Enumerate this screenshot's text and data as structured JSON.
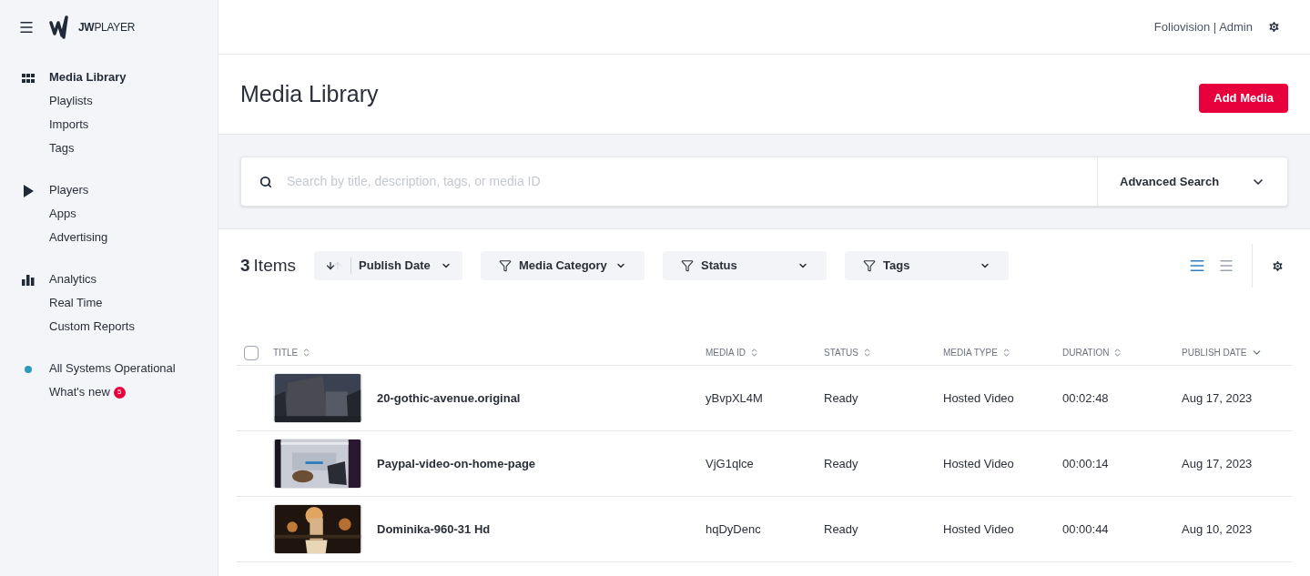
{
  "logo": {
    "text": "**JW**PLAYER"
  },
  "sidebar": {
    "groups": [
      {
        "items": [
          {
            "label": "Media Library",
            "selected": true
          },
          {
            "label": "Playlists",
            "selected": false
          },
          {
            "label": "Imports",
            "selected": false
          },
          {
            "label": "Tags",
            "selected": false
          }
        ]
      },
      {
        "items": [
          {
            "label": "Players",
            "selected": false
          },
          {
            "label": "Apps",
            "selected": false
          },
          {
            "label": "Advertising",
            "selected": false
          }
        ]
      },
      {
        "items": [
          {
            "label": "Analytics",
            "selected": false
          },
          {
            "label": "Real Time",
            "selected": false
          },
          {
            "label": "Custom Reports",
            "selected": false
          }
        ]
      },
      {
        "items": [
          {
            "label": "All Systems Operational",
            "selected": false
          },
          {
            "label": "What's new",
            "selected": false,
            "badge": "5"
          }
        ]
      }
    ]
  },
  "header": {
    "account": "Foliovision | Admin"
  },
  "page": {
    "title": "Media Library",
    "primary_button": "Add Media"
  },
  "search": {
    "placeholder": "Search by title, description, tags, or media ID",
    "advanced": "Advanced Search"
  },
  "toolbar": {
    "count": "3",
    "count_label": "Items",
    "filters": [
      {
        "kind": "sort",
        "label": "Publish Date"
      },
      {
        "kind": "filter",
        "label": "Media Category"
      },
      {
        "kind": "filter",
        "label": "Status"
      },
      {
        "kind": "filter",
        "label": "Tags"
      }
    ],
    "views": [
      {
        "kind": "list",
        "selected": true
      },
      {
        "kind": "compact",
        "selected": false
      }
    ]
  },
  "table": {
    "select_all": {
      "checked": false
    },
    "columns": [
      {
        "label": "TITLE",
        "sorted": false
      },
      {
        "label": "MEDIA ID",
        "sorted": false
      },
      {
        "label": "STATUS",
        "sorted": false
      },
      {
        "label": "MEDIA TYPE",
        "sorted": false
      },
      {
        "label": "DURATION",
        "sorted": false
      },
      {
        "label": "PUBLISH DATE",
        "sorted": true
      }
    ],
    "rows": [
      {
        "title": "20-gothic-avenue.original",
        "media_id": "yBvpXL4M",
        "status": "Ready",
        "media_type": "Hosted Video",
        "duration": "00:02:48",
        "publish_date": "Aug 17, 2023"
      },
      {
        "title": "Paypal-video-on-home-page",
        "media_id": "VjG1qlce",
        "status": "Ready",
        "media_type": "Hosted Video",
        "duration": "00:00:14",
        "publish_date": "Aug 17, 2023"
      },
      {
        "title": "Dominika-960-31 Hd",
        "media_id": "hqDyDenc",
        "status": "Ready",
        "media_type": "Hosted Video",
        "duration": "00:00:44",
        "publish_date": "Aug 10, 2023"
      }
    ]
  }
}
